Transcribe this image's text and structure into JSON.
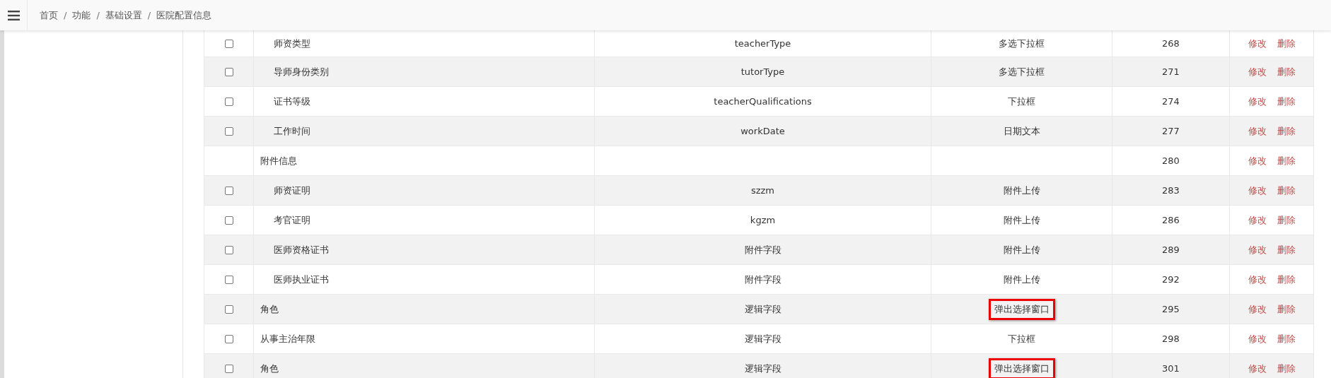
{
  "breadcrumb": [
    {
      "label": "首页"
    },
    {
      "separator": "/",
      "label": "功能"
    },
    {
      "separator": "/",
      "label": "基础设置"
    },
    {
      "separator": "/",
      "label": "医院配置信息"
    }
  ],
  "rows": [
    {
      "children": [
        {
          "name": "师资类型",
          "field": "teacherType",
          "type": "多选下拉框",
          "order": "268",
          "checked": false,
          "highlighted": false,
          "actions": [
            "修改",
            "删除"
          ]
        },
        {
          "name": "导师身份类别",
          "field": "tutorType",
          "type": "多选下拉框",
          "order": "271",
          "checked": false,
          "highlighted": false,
          "actions": [
            "修改",
            "删除"
          ]
        },
        {
          "name": "证书等级",
          "field": "teacherQualifications",
          "type": "下拉框",
          "order": "274",
          "checked": false,
          "highlighted": false,
          "actions": [
            "修改",
            "删除"
          ]
        },
        {
          "name": "工作时间",
          "field": "workDate",
          "type": "日期文本",
          "order": "277",
          "checked": false,
          "highlighted": false,
          "actions": [
            "修改",
            "删除"
          ]
        }
      ]
    },
    {
      "name": "附件信息",
      "order": "280",
      "highlighted": false,
      "actions": [
        "修改",
        "删除"
      ],
      "children": [
        {
          "name": "师资证明",
          "field": "szzm",
          "type": "附件上传",
          "order": "283",
          "checked": false,
          "highlighted": false,
          "actions": [
            "修改",
            "删除"
          ]
        },
        {
          "name": "考官证明",
          "field": "kgzm",
          "type": "附件上传",
          "order": "286",
          "checked": false,
          "highlighted": false,
          "actions": [
            "修改",
            "删除"
          ]
        },
        {
          "name": "医师资格证书",
          "field": "附件字段",
          "type": "附件上传",
          "order": "289",
          "checked": false,
          "highlighted": false,
          "actions": [
            "修改",
            "删除"
          ]
        },
        {
          "name": "医师执业证书",
          "field": "附件字段",
          "type": "附件上传",
          "order": "292",
          "checked": false,
          "highlighted": false,
          "actions": [
            "修改",
            "删除"
          ]
        }
      ]
    },
    {
      "name": "角色",
      "field": "逻辑字段",
      "type": "弹出选择窗口",
      "order": "295",
      "checked": false,
      "highlighted": true,
      "actions": [
        "修改",
        "删除"
      ]
    },
    {
      "name": "从事主治年限",
      "field": "逻辑字段",
      "type": "下拉框",
      "order": "298",
      "checked": false,
      "highlighted": false,
      "actions": [
        "修改",
        "删除"
      ]
    },
    {
      "name": "角色",
      "field": "逻辑字段",
      "type": "弹出选择窗口",
      "order": "301",
      "checked": false,
      "highlighted": true,
      "actions": [
        "修改",
        "删除"
      ]
    }
  ]
}
